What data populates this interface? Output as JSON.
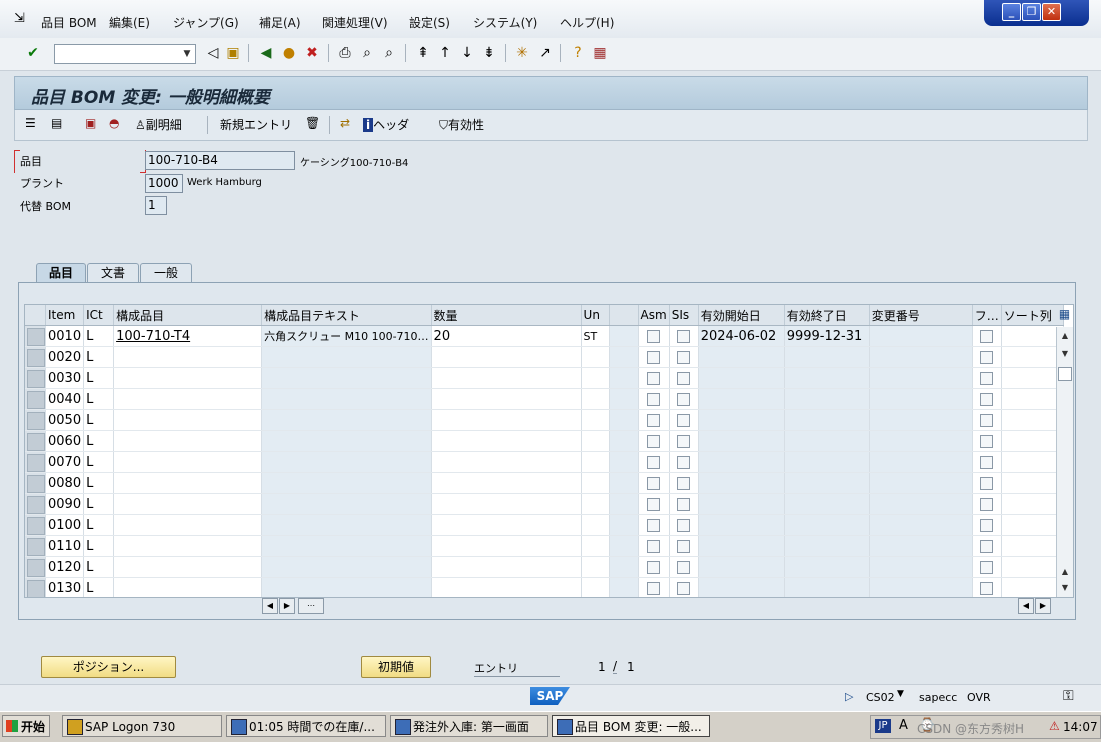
{
  "menu": {
    "items": [
      "品目 BOM",
      "編集(E)",
      "ジャンプ(G)",
      "補足(A)",
      "関連処理(V)",
      "設定(S)",
      "システム(Y)",
      "ヘルプ(H)"
    ]
  },
  "window_controls": {
    "minimize": "_",
    "restore": "❐",
    "close": "✕"
  },
  "toolbar": {
    "command_field_value": ""
  },
  "title": "品目 BOM 変更: 一般明細概要",
  "app_toolbar": {
    "sub_item_label": "副明細",
    "new_entry_label": "新規エントリ",
    "header_label": "ヘッダ",
    "validity_label": "有効性"
  },
  "header": {
    "material_label": "品目",
    "material_value": "100-710-B4",
    "material_desc": "ケーシング100-710-B4",
    "plant_label": "プラント",
    "plant_value": "1000",
    "plant_desc": "Werk Hamburg",
    "alt_bom_label": "代替 BOM",
    "alt_bom_value": "1"
  },
  "tabs": [
    "品目",
    "文書",
    "一般"
  ],
  "table": {
    "columns": [
      "Item",
      "ICt",
      "構成品目",
      "構成品目テキスト",
      "数量",
      "Un",
      "",
      "Asm",
      "SIs",
      "有効開始日",
      "有効終了日",
      "変更番号",
      "フ…",
      "ソート列"
    ],
    "rows": [
      {
        "item": "0010",
        "ict": "L",
        "component": "100-710-T4",
        "text": "六角スクリュー M10 100-710…",
        "qty": "20",
        "un": "ST",
        "from": "2024-06-02",
        "to": "9999-12-31"
      },
      {
        "item": "0020",
        "ict": "L",
        "component": "",
        "text": "",
        "qty": "",
        "un": "",
        "from": "",
        "to": ""
      },
      {
        "item": "0030",
        "ict": "L",
        "component": "",
        "text": "",
        "qty": "",
        "un": "",
        "from": "",
        "to": ""
      },
      {
        "item": "0040",
        "ict": "L",
        "component": "",
        "text": "",
        "qty": "",
        "un": "",
        "from": "",
        "to": ""
      },
      {
        "item": "0050",
        "ict": "L",
        "component": "",
        "text": "",
        "qty": "",
        "un": "",
        "from": "",
        "to": ""
      },
      {
        "item": "0060",
        "ict": "L",
        "component": "",
        "text": "",
        "qty": "",
        "un": "",
        "from": "",
        "to": ""
      },
      {
        "item": "0070",
        "ict": "L",
        "component": "",
        "text": "",
        "qty": "",
        "un": "",
        "from": "",
        "to": ""
      },
      {
        "item": "0080",
        "ict": "L",
        "component": "",
        "text": "",
        "qty": "",
        "un": "",
        "from": "",
        "to": ""
      },
      {
        "item": "0090",
        "ict": "L",
        "component": "",
        "text": "",
        "qty": "",
        "un": "",
        "from": "",
        "to": ""
      },
      {
        "item": "0100",
        "ict": "L",
        "component": "",
        "text": "",
        "qty": "",
        "un": "",
        "from": "",
        "to": ""
      },
      {
        "item": "0110",
        "ict": "L",
        "component": "",
        "text": "",
        "qty": "",
        "un": "",
        "from": "",
        "to": ""
      },
      {
        "item": "0120",
        "ict": "L",
        "component": "",
        "text": "",
        "qty": "",
        "un": "",
        "from": "",
        "to": ""
      },
      {
        "item": "0130",
        "ict": "L",
        "component": "",
        "text": "",
        "qty": "",
        "un": "",
        "from": "",
        "to": ""
      }
    ]
  },
  "bottom": {
    "position_button": "ポジション...",
    "initial_button": "初期値",
    "entry_label": "エントリ",
    "page_current": "1",
    "page_sep": "/",
    "page_total": "1"
  },
  "status": {
    "sap_logo": "SAP",
    "tcode": "CS02",
    "server": "sapecc",
    "mode": "OVR"
  },
  "taskbar": {
    "start": "开始",
    "tasks": [
      "SAP Logon 730",
      "01:05 時間での在庫/...",
      "発注外入庫: 第一画面",
      "品目 BOM 変更: 一般..."
    ],
    "lang": "JP",
    "watermark": "CSDN @东方秀树H",
    "clock": "14:07"
  }
}
